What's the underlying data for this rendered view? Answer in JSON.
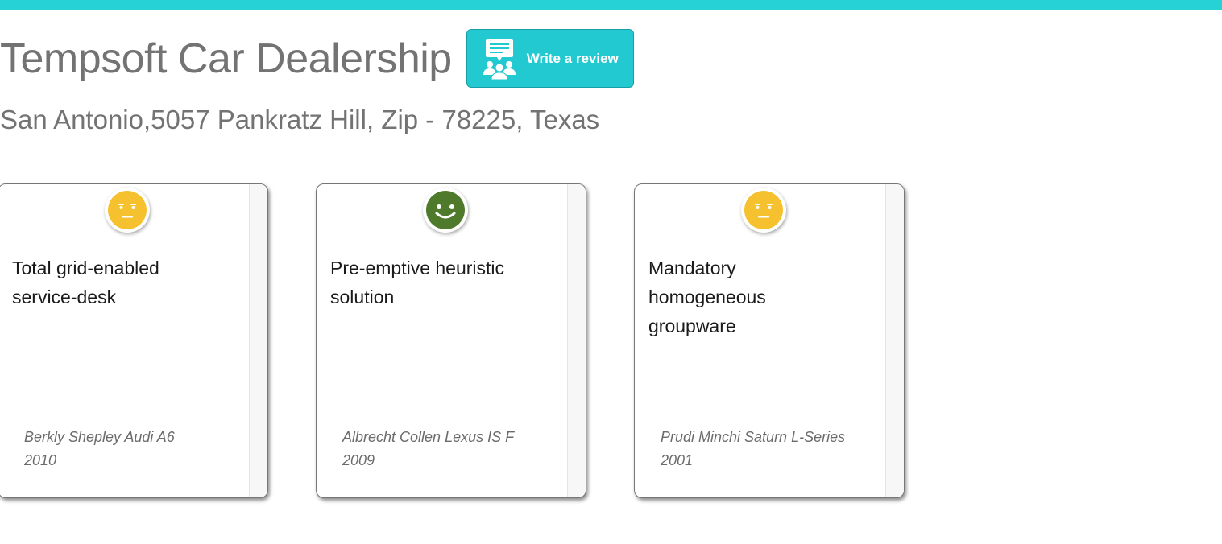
{
  "header": {
    "title": "Tempsoft Car Dealership",
    "write_review_label": "Write a review",
    "write_review_icon": "group-chat-icon"
  },
  "dealer": {
    "address": "San Antonio,5057 Pankratz Hill, Zip - 78225, Texas"
  },
  "colors": {
    "accent": "#27d2d7",
    "neutral_emoji": "#f6c12e",
    "positive_emoji": "#4f7a2b"
  },
  "reviews": [
    {
      "sentiment": "neutral",
      "emoji_icon": "neutral-face-icon",
      "text": "Total grid-enabled service-desk",
      "reviewer": "Berkly Shepley Audi A6 2010"
    },
    {
      "sentiment": "positive",
      "emoji_icon": "smiling-face-icon",
      "text": "Pre-emptive heuristic solution",
      "reviewer": "Albrecht Collen Lexus IS F 2009"
    },
    {
      "sentiment": "neutral",
      "emoji_icon": "neutral-face-icon",
      "text": "Mandatory homogeneous groupware",
      "reviewer": "Prudi Minchi Saturn L-Series 2001"
    }
  ]
}
